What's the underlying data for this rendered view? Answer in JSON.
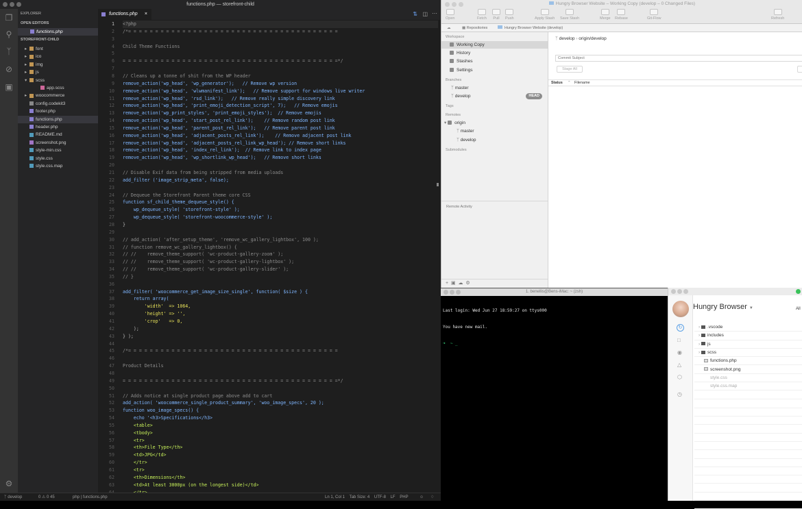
{
  "vscode": {
    "title": "functions.php — storefront-child",
    "sidebar": {
      "explorer_label": "EXPLORER",
      "open_editors_label": "OPEN EDITORS",
      "open_files": [
        "functions.php"
      ],
      "project_label": "STOREFRONT-CHILD",
      "tree": [
        {
          "label": "font",
          "indent": 1,
          "kind": "folder"
        },
        {
          "label": "ico",
          "indent": 1,
          "kind": "folder"
        },
        {
          "label": "img",
          "indent": 1,
          "kind": "folder"
        },
        {
          "label": "js",
          "indent": 1,
          "kind": "folder"
        },
        {
          "label": "scss",
          "indent": 1,
          "kind": "folder-open"
        },
        {
          "label": "app.scss",
          "indent": 2,
          "kind": "scss"
        },
        {
          "label": "woocommerce",
          "indent": 1,
          "kind": "folder"
        },
        {
          "label": "config.codekit3",
          "indent": 1,
          "kind": "file"
        },
        {
          "label": "footer.php",
          "indent": 1,
          "kind": "php"
        },
        {
          "label": "functions.php",
          "indent": 1,
          "kind": "php"
        },
        {
          "label": "header.php",
          "indent": 1,
          "kind": "php"
        },
        {
          "label": "README.md",
          "indent": 1,
          "kind": "md"
        },
        {
          "label": "screenshot.png",
          "indent": 1,
          "kind": "img"
        },
        {
          "label": "style-min.css",
          "indent": 1,
          "kind": "css"
        },
        {
          "label": "style.css",
          "indent": 1,
          "kind": "css"
        },
        {
          "label": "style.css.map",
          "indent": 1,
          "kind": "css"
        }
      ]
    },
    "tab_label": "functions.php",
    "code_lines": [
      "<?php",
      "/*= = = = = = = = = = = = = = = = = = = = = = = = = = = = = = = = = = = = = = =",
      "",
      "Child Theme Functions",
      "",
      "= = = = = = = = = = = = = = = = = = = = = = = = = = = = = = = = = = = = = = = =*/",
      "",
      "// Cleans up a tonne of shit from the WP header",
      "remove_action('wp_head', 'wp_generator');   // Remove wp version",
      "remove_action('wp_head', 'wlwmanifest_link');   // Remove support for windows live writer",
      "remove_action('wp_head', 'rsd_link');   // Remove really simple discovery link",
      "remove_action('wp_head', 'print_emoji_detection_script', 7);   // Remove emojis",
      "remove_action('wp_print_styles', 'print_emoji_styles');  // Remove emojis",
      "remove_action('wp_head', 'start_post_rel_link');    // Remove random post link",
      "remove_action('wp_head', 'parent_post_rel_link');   // Remove parent post link",
      "remove_action('wp_head', 'adjacent_posts_rel_link');    // Remove adjacent post link",
      "remove_action('wp_head', 'adjacent_posts_rel_link_wp_head'); // Remove short links",
      "remove_action('wp_head', 'index_rel_link');  // Remove link to index page",
      "remove_action('wp_head', 'wp_shortlink_wp_head');   // Remove short links",
      "",
      "// Disable Exif data from being stripped from media uploads",
      "add_filter ('image_strip_meta', false);",
      "",
      "// Dequeue the Storefront Parent theme core CSS",
      "function sf_child_theme_dequeue_style() {",
      "    wp_dequeue_style( 'storefront-style' );",
      "    wp_dequeue_style( 'storefront-woocommerce-style' );",
      "}",
      "",
      "// add_action( 'after_setup_theme', 'remove_wc_gallery_lightbox', 100 );",
      "// function remove_wc_gallery_lightbox() {",
      "// //    remove_theme_support( 'wc-product-gallery-zoom' );",
      "// //    remove_theme_support( 'wc-product-gallery-lightbox' );",
      "// //    remove_theme_support( 'wc-product-gallery-slider' );",
      "// }",
      "",
      "add_filter( 'woocommerce_get_image_size_single', function( $size ) {",
      "    return array(",
      "        'width'  => 1064,",
      "        'height' => '',",
      "        'crop'   => 0,",
      "    );",
      "} );",
      "",
      "/*= = = = = = = = = = = = = = = = = = = = = = = = = = = = = = = = = = = = = = =",
      "",
      "Product Details",
      "",
      "= = = = = = = = = = = = = = = = = = = = = = = = = = = = = = = = = = = = = = = =*/",
      "",
      "// Adds notice at single product page above add to cart",
      "add_action( 'woocommerce_single_product_summary', 'woo_image_specs', 20 );",
      "function woo_image_specs() {",
      "    echo '<h3>Specifications</h3>",
      "    <table>",
      "    <tbody>",
      "    <tr>",
      "    <th>File Type</th>",
      "    <td>JPG</td>",
      "    </tr>",
      "    <tr>",
      "    <th>Dimensions</th>",
      "    <td>At least 3000px (on the longest side)</td>",
      "    </tr>"
    ],
    "status_left": "develop",
    "status_problems": "0 ⚠ 0 45",
    "status_path": "php | functions.php",
    "status_right": "Ln 1, Col 1    Tab Size: 4    UTF-8    LF    PHP"
  },
  "tower": {
    "title": "Hungry Browser Website – Working Copy (develop – 0 Changed Files)",
    "toolbar": [
      "Open",
      "Fetch",
      "Pull",
      "Push",
      "Apply Stash",
      "Save Stash",
      "Merge",
      "Rebase",
      "Git-Flow",
      "Refresh"
    ],
    "breadcrumb_repos": "Repositories",
    "breadcrumb_repo": "Hungry Browser Website (develop)",
    "workspace_label": "Workspace",
    "workspace_items": [
      "Working Copy",
      "History",
      "Stashes",
      "Settings"
    ],
    "branches_label": "Branches",
    "branches": [
      "master",
      "develop"
    ],
    "head_badge": "HEAD",
    "tags_label": "Tags",
    "remotes_label": "Remotes",
    "remote_name": "origin",
    "remote_branches": [
      "master",
      "develop"
    ],
    "submodules_label": "Submodules",
    "remote_activity": "Remote Activity",
    "branch_local": "develop",
    "branch_remote": "origin/develop",
    "commit_placeholder": "Commit Subject",
    "stage_all": "Stage All",
    "col_status": "Status",
    "col_filename": "Filename"
  },
  "terminal": {
    "title": "1. benellis@Bens-iMac: ~ (zsh)",
    "lines": [
      "Last login: Wed Jun 27 18:59:27 on ttys000",
      "You have new mail.",
      "➜  ~ _"
    ]
  },
  "hungry": {
    "title": "Hungry Browser",
    "right_label": "All",
    "files": [
      {
        "name": ".vscode",
        "kind": "folder"
      },
      {
        "name": "includes",
        "kind": "folder"
      },
      {
        "name": "js",
        "kind": "folder"
      },
      {
        "name": "scss",
        "kind": "folder"
      },
      {
        "name": "functions.php",
        "kind": "file"
      },
      {
        "name": "screenshot.png",
        "kind": "img"
      },
      {
        "name": "style.css",
        "kind": "dim"
      },
      {
        "name": "style.css.map",
        "kind": "dim"
      }
    ]
  }
}
